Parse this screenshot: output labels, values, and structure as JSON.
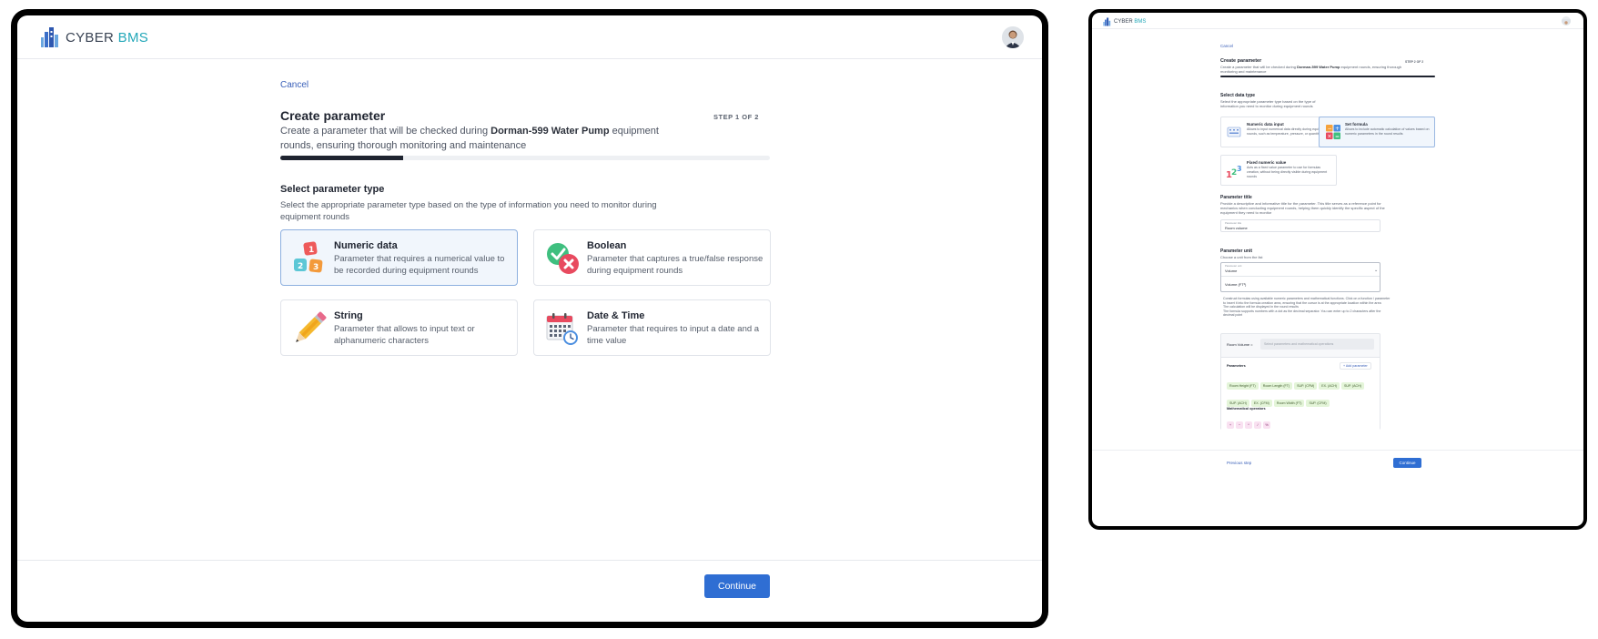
{
  "app": {
    "brand_part1": "CYBER",
    "brand_part2": "BMS"
  },
  "main": {
    "cancel_label": "Cancel",
    "title": "Create parameter",
    "step_label": "STEP 1 OF 2",
    "description_prefix": "Create a parameter that will be checked during",
    "equipment_name": "Dorman-599 Water Pump",
    "description_suffix": "equipment rounds, ensuring thorough monitoring and maintenance",
    "progress": 0.25,
    "section_title": "Select parameter type",
    "section_description": "Select the appropriate parameter type based on the type of information you need to monitor during equipment rounds",
    "types": [
      {
        "title": "Numeric data",
        "description": "Parameter that requires a numerical value to be recorded during equipment rounds",
        "icon": "numeric-blocks-icon",
        "selected": true
      },
      {
        "title": "Boolean",
        "description": "Parameter that captures a true/false response during equipment rounds",
        "icon": "check-cross-icon",
        "selected": false
      },
      {
        "title": "String",
        "description": "Parameter that allows to input text or alphanumeric characters",
        "icon": "pencil-icon",
        "selected": false
      },
      {
        "title": "Date & Time",
        "description": "Parameter that requires to input a date and a time value",
        "icon": "calendar-clock-icon",
        "selected": false
      }
    ],
    "continue_label": "Continue"
  },
  "preview": {
    "cancel_label": "Cancel",
    "title": "Create parameter",
    "step_label": "STEP 2 OF 2",
    "description_prefix": "Create a parameter that will be checked during",
    "equipment_name": "Dorman-599 Water Pump",
    "description_suffix": "equipment rounds, ensuring thorough monitoring and maintenance",
    "data_type_title": "Select data type",
    "data_type_desc": "Select the appropriate parameter type based on the type of information you need to monitor during equipment rounds",
    "data_types": [
      {
        "title": "Numeric data input",
        "description": "Allows to input numerical data directly during equipment rounds, such as temperature, pressure, or quantity"
      },
      {
        "title": "Set formula",
        "description": "Allows to include automatic calculation of values based on numeric parameters in the round results"
      },
      {
        "title": "Fixed numeric value",
        "description": "Acts as a fixed value parameter to use for formulas creation, without being directly visible during equipment rounds"
      }
    ],
    "param_title_heading": "Parameter title",
    "param_title_desc": "Provide a descriptive and informative title for the parameter. This title serves as a reference point for mechanics when conducting equipment rounds, helping them quickly identify the specific aspect of the equipment they need to monitor",
    "param_title_field_label": "Parameter title",
    "param_title_value": "Room volume",
    "param_unit_heading": "Parameter unit",
    "param_unit_desc": "Choose a unit from the list",
    "param_unit_field_label": "Parameter unit",
    "param_unit_value": "Volume",
    "param_unit_option": "Volume (FT³)",
    "formula_notes": [
      "Construct formulas using available numeric parameters and mathematical functions. Click on a function / parameter to insert it into the formula creation area, ensuring that the cursor is at the appropriate location within the area",
      "The calculation will be displayed in the round results",
      "The formula supports numbers with a dot as the decimal separator. You can enter up to 2 characters after the decimal point"
    ],
    "formula_label": "Room Volume =",
    "formula_placeholder": "Select parameters and mathematical operations",
    "parameters_heading": "Parameters",
    "add_parameter_label": "+ Add parameter",
    "parameter_chips": [
      "Room Height (FT)",
      "Room Length (FT)",
      "SUP. (CFM)",
      "EX. (ACH)",
      "SUP. (ACH)",
      "SUP. (ACH)",
      "EX. (CFM)",
      "Room Width (FT)",
      "SUP. (CFM)"
    ],
    "operators_heading": "Mathematical operators",
    "operators": [
      "+",
      "−",
      "*",
      "/",
      "%"
    ],
    "previous_label": "Previous step",
    "continue_label": "Continue"
  }
}
